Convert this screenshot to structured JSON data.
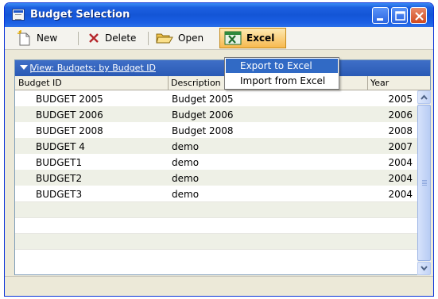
{
  "window": {
    "title": "Budget Selection"
  },
  "toolbar": {
    "new_label": "New",
    "delete_label": "Delete",
    "open_label": "Open",
    "excel_label": "Excel"
  },
  "excel_menu": {
    "items": [
      {
        "label": "Export to Excel",
        "highlighted": true
      },
      {
        "label": "Import from Excel",
        "highlighted": false
      }
    ]
  },
  "view": {
    "label": "View: Budgets; by Budget ID"
  },
  "table": {
    "columns": [
      "Budget ID",
      "Description",
      "Year"
    ],
    "rows": [
      {
        "id": "BUDGET 2005",
        "description": "Budget 2005",
        "year": "2005"
      },
      {
        "id": "BUDGET 2006",
        "description": "Budget 2006",
        "year": "2006"
      },
      {
        "id": "BUDGET 2008",
        "description": "Budget 2008",
        "year": "2008"
      },
      {
        "id": "BUDGET 4",
        "description": "demo",
        "year": "2007"
      },
      {
        "id": "BUDGET1",
        "description": "demo",
        "year": "2004"
      },
      {
        "id": "BUDGET2",
        "description": "demo",
        "year": "2004"
      },
      {
        "id": "BUDGET3",
        "description": "demo",
        "year": "2004"
      }
    ]
  },
  "icons": {
    "app": "window-icon",
    "new": "new-document-icon",
    "delete": "delete-x-icon",
    "open": "open-folder-icon",
    "excel": "excel-icon"
  },
  "colors": {
    "titlebar": "#1455d6",
    "view_bar": "#2a5ab5",
    "menu_highlight": "#316ac5",
    "excel_button": "#f7b94f"
  }
}
